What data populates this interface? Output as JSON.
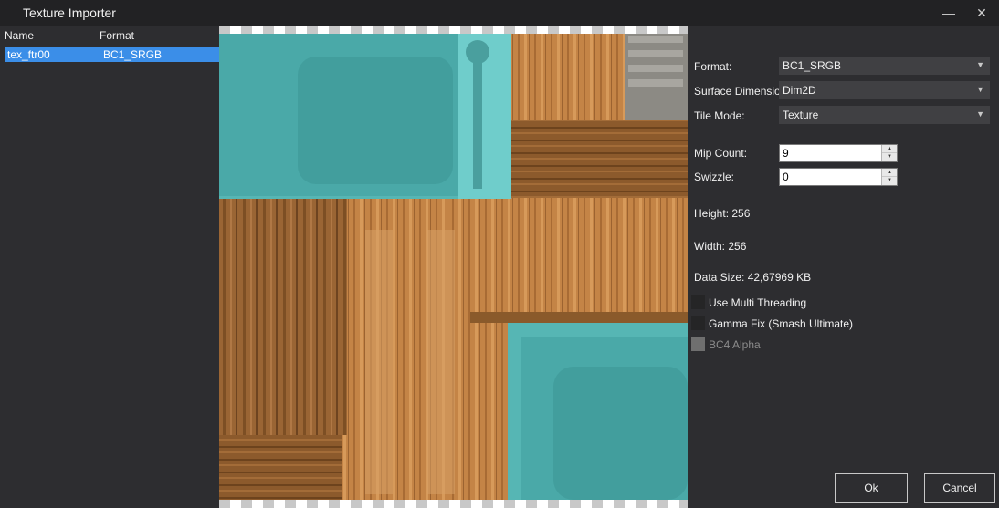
{
  "window": {
    "title": "Texture Importer"
  },
  "list": {
    "columns": [
      "Name",
      "Format"
    ],
    "rows": [
      {
        "name": "tex_ftr00",
        "format": "BC1_SRGB"
      }
    ]
  },
  "settings": {
    "format_label": "Format:",
    "format_value": "BC1_SRGB",
    "surface_label": "Surface Dimension:",
    "surface_value": "Dim2D",
    "tile_label": "Tile Mode:",
    "tile_value": "Texture",
    "mip_label": "Mip Count:",
    "mip_value": "9",
    "swizzle_label": "Swizzle:",
    "swizzle_value": "0",
    "height_text": "Height: 256",
    "width_text": "Width: 256",
    "datasize_text": "Data Size: 42,67969 KB",
    "multithread_label": "Use Multi Threading",
    "multithread_checked": false,
    "gamma_label": "Gamma Fix (Smash Ultimate)",
    "gamma_checked": false,
    "bc4_label": "BC4 Alpha",
    "bc4_enabled": false
  },
  "buttons": {
    "ok": "Ok",
    "cancel": "Cancel"
  },
  "colors": {
    "background": "#2d2d30",
    "titlebar": "#222224",
    "selection": "#3b8ee8",
    "teal": "#55b8b8",
    "wood_light": "#c9894a",
    "wood_dark": "#8a5a2b"
  }
}
